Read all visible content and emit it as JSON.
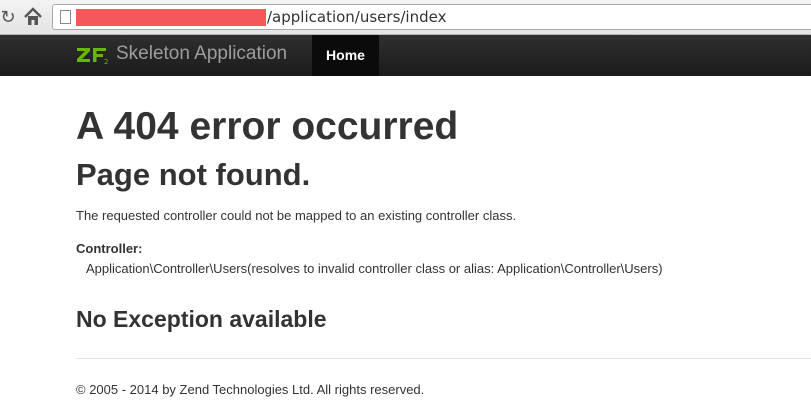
{
  "browser": {
    "url_path": "/application/users/index",
    "reload_icon": "reload-icon",
    "home_icon": "home-icon",
    "page_icon": "page-icon",
    "redaction_color": "#f5585a"
  },
  "navbar": {
    "brand": "Skeleton Application",
    "logo_icon": "zf-logo-icon",
    "logo_color": "#68b604",
    "home_label": "Home"
  },
  "content": {
    "heading": "A 404 error occurred",
    "subheading": "Page not found.",
    "message": "The requested controller could not be mapped to an existing controller class.",
    "controller_label": "Controller:",
    "controller_value": "Application\\Controller\\Users(resolves to invalid controller class or alias: Application\\Controller\\Users)",
    "exception_heading": "No Exception available"
  },
  "footer": {
    "text": "© 2005 - 2014 by Zend Technologies Ltd. All rights reserved."
  }
}
